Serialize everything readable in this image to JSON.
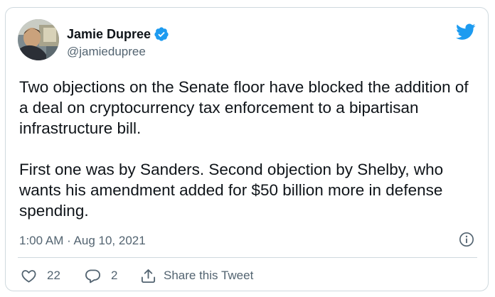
{
  "author": {
    "display_name": "Jamie Dupree",
    "handle": "@jamiedupree",
    "verified": true
  },
  "tweet": {
    "text": "Two objections on the Senate floor have blocked the addition of a deal on cryptocurrency tax enforcement to a bipartisan infrastructure bill.\n\nFirst one was by Sanders. Second objection by Shelby, who wants his amendment added for $50 billion more in defense spending.",
    "timestamp": "1:00 AM · Aug 10, 2021"
  },
  "actions": {
    "likes": "22",
    "replies": "2",
    "share_label": "Share this Tweet"
  },
  "colors": {
    "brand": "#1d9bf0",
    "secondary_text": "#536471",
    "border": "#cfd9de"
  },
  "icons": [
    "verified-badge-icon",
    "twitter-bird-icon",
    "info-icon",
    "heart-icon",
    "reply-bubble-icon",
    "share-icon"
  ]
}
